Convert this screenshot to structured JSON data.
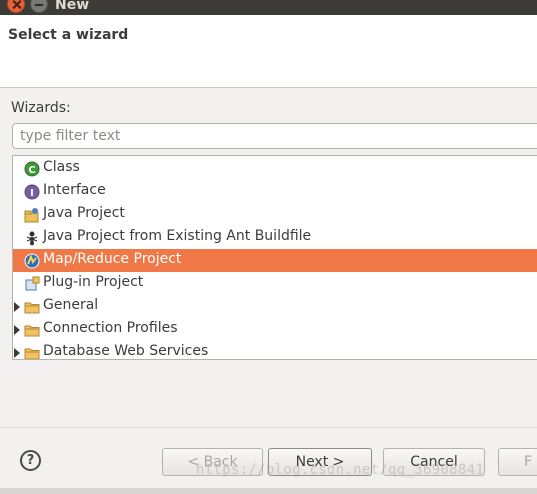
{
  "window": {
    "title": "New"
  },
  "header": {
    "title": "Select a wizard"
  },
  "wizards": {
    "label": "Wizards:",
    "filter_placeholder": "type filter text",
    "items": [
      {
        "label": "Class",
        "icon": "class-icon",
        "selected": false
      },
      {
        "label": "Interface",
        "icon": "interface-icon",
        "selected": false
      },
      {
        "label": "Java Project",
        "icon": "java-project-icon",
        "selected": false
      },
      {
        "label": "Java Project from Existing Ant Buildfile",
        "icon": "ant-icon",
        "selected": false
      },
      {
        "label": "Map/Reduce Project",
        "icon": "mapreduce-icon",
        "selected": true
      },
      {
        "label": "Plug-in Project",
        "icon": "plugin-icon",
        "selected": false
      },
      {
        "label": "General",
        "icon": "folder-icon",
        "expandable": true
      },
      {
        "label": "Connection Profiles",
        "icon": "folder-icon",
        "expandable": true
      },
      {
        "label": "Database Web Services",
        "icon": "folder-icon",
        "expandable": true
      }
    ]
  },
  "buttons": {
    "help": "?",
    "back": "< Back",
    "next": "Next >",
    "cancel": "Cancel",
    "finish": "F"
  },
  "watermark": "https://blog.csdn.net/qq_36908841",
  "colors": {
    "selection": "#f07746",
    "titlebar": "#3c3b37",
    "close": "#e9613a"
  }
}
